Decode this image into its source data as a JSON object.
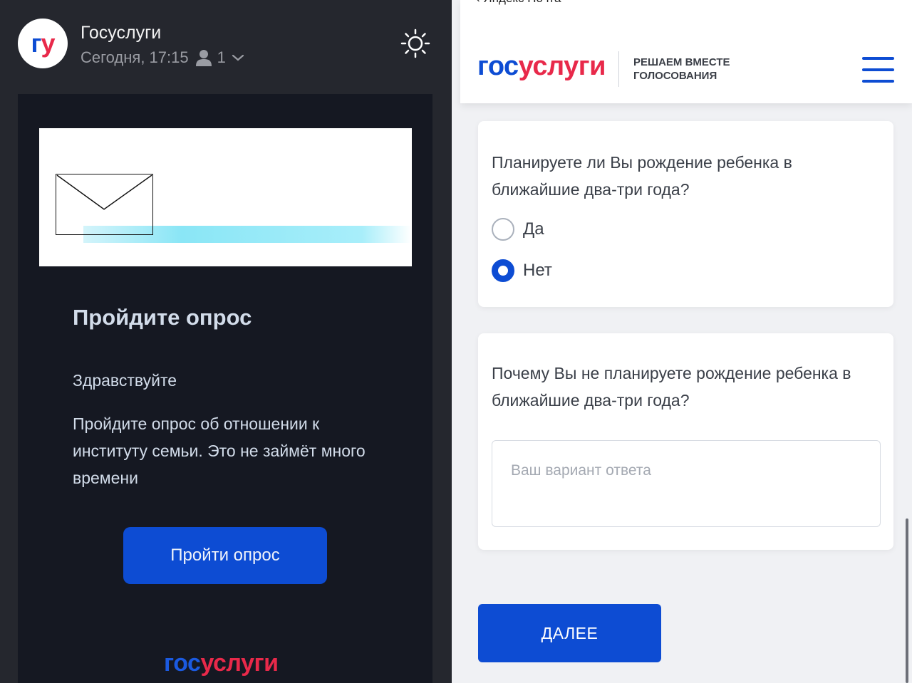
{
  "mail": {
    "sender": "Госуслуги",
    "avatar_text_g": "г",
    "avatar_text_u": "у",
    "meta_time": "Сегодня, 17:15",
    "recipient_count": "1",
    "icons": {
      "theme_toggle": "sun-icon",
      "recipient": "person-icon",
      "expand": "chevron-down-icon",
      "envelope": "envelope-icon"
    },
    "title": "Пройдите опрос",
    "greeting": "Здравствуйте",
    "body": "Пройдите опрос об отношении к институту семьи. Это не займёт много времени",
    "cta_label": "Пройти опрос",
    "footer_logo_g": "гос",
    "footer_logo_u": "услуги"
  },
  "form": {
    "back_link": "‹ Яндекс Почта",
    "logo_g": "гос",
    "logo_u": "услуги",
    "tagline_line1": "РЕШАЕМ ВМЕСТЕ",
    "tagline_line2": "ГОЛОСОВАНИЯ",
    "menu_icon": "hamburger-menu-icon",
    "question1": "Планируете ли Вы рождение ребенка в ближайшие два-три года?",
    "options": [
      {
        "label": "Да",
        "selected": false
      },
      {
        "label": "Нет",
        "selected": true
      }
    ],
    "question2": "Почему Вы не планируете рождение ребенка в ближайшие два-три года?",
    "answer_placeholder": "Ваш вариант ответа",
    "answer_value": "",
    "next_label": "ДАЛЕЕ"
  },
  "colors": {
    "brand_blue": "#0d4cd3",
    "brand_red": "#e8294a",
    "dark_bg": "#25272e",
    "mail_card_bg": "#151822"
  }
}
